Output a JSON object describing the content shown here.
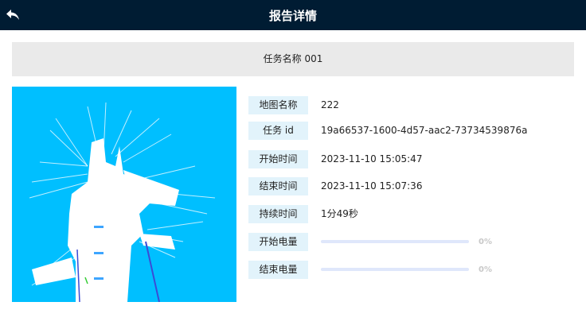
{
  "header": {
    "title": "报告详情",
    "back_icon": "back-arrow-icon"
  },
  "task": {
    "name": "任务名称 001"
  },
  "map": {
    "background_color": "#00bfff"
  },
  "info": {
    "map_name": {
      "label": "地图名称",
      "value": "222"
    },
    "task_id": {
      "label": "任务 id",
      "value": "19a66537-1600-4d57-aac2-73734539876a"
    },
    "start_time": {
      "label": "开始时间",
      "value": "2023-11-10 15:05:47"
    },
    "end_time": {
      "label": "结束时间",
      "value": "2023-11-10 15:07:36"
    },
    "duration": {
      "label": "持续时间",
      "value": "1分49秒"
    },
    "start_battery": {
      "label": "开始电量",
      "percent": 0,
      "text": "0%"
    },
    "end_battery": {
      "label": "结束电量",
      "percent": 0,
      "text": "0%"
    }
  },
  "colors": {
    "header_bg": "#001c33",
    "label_bg": "#e2f3fb",
    "bar_track": "#dfe7fb"
  }
}
